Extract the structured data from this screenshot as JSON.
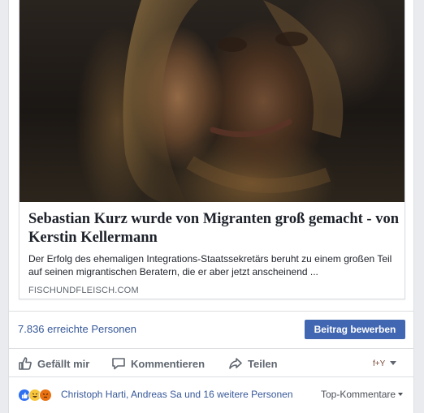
{
  "link_preview": {
    "title": "Sebastian Kurz wurde von Migranten groß gemacht - von Kerstin Kellermann",
    "description": "Der Erfolg des ehemaligen Integrations-Staatssekretärs beruht zu einem großen Teil auf seinen migrantischen Beratern, die er aber jetzt anscheinend ...",
    "domain": "FISCHUNDFLEISCH.COM",
    "image_icon": "portrait-photo"
  },
  "stats": {
    "reach": "7.836 erreichte Personen",
    "boost_label": "Beitrag bewerben"
  },
  "actions": {
    "like_label": "Gefällt mir",
    "comment_label": "Kommentieren",
    "share_label": "Teilen",
    "viewer_icon": "page-avatar-icon"
  },
  "reactions": {
    "icons": [
      "like-icon",
      "haha-icon",
      "angry-icon"
    ],
    "summary": "Christoph Harti, Andreas Sa und 16 weitere Personen",
    "sort_label": "Top-Kommentare"
  },
  "colors": {
    "link": "#365899",
    "button": "#4267b2",
    "muted": "#606770"
  }
}
